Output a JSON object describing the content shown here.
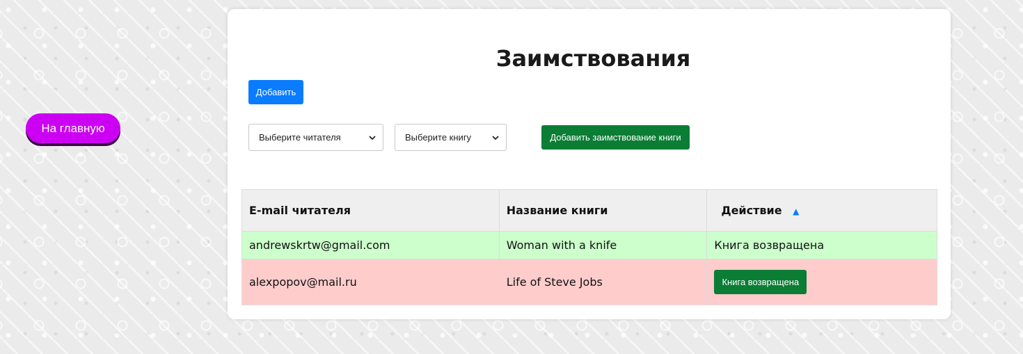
{
  "nav": {
    "home_label": "На главную"
  },
  "page": {
    "title": "Заимствования"
  },
  "toolbar": {
    "add_label": "Добавить",
    "reader_select": "Выберите читателя",
    "book_select": "Выберите книгу",
    "add_borrow_label": "Добавить заимствование книги"
  },
  "table": {
    "headers": {
      "email": "E-mail читателя",
      "title": "Название книги",
      "action": "Действие",
      "sort_indicator": "▲"
    },
    "rows": [
      {
        "email": "andrewskrtw@gmail.com",
        "book": "Woman with a knife",
        "action_text": "Книга возвращена",
        "status": "returned"
      },
      {
        "email": "alexpopov@mail.ru",
        "book": "Life of Steve Jobs",
        "action_button": "Книга возвращена",
        "status": "pending"
      }
    ]
  },
  "colors": {
    "home_button": "#cc00f2",
    "primary": "#0a7cff",
    "success": "#0b7d34",
    "row_returned": "#ccffcc",
    "row_pending": "#ffcccc"
  }
}
